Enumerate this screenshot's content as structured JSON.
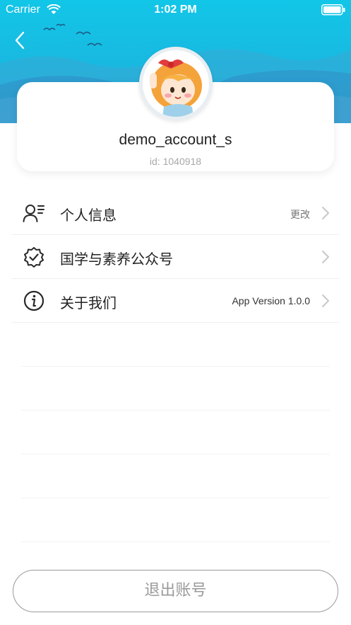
{
  "status_bar": {
    "carrier": "Carrier",
    "time": "1:02 PM"
  },
  "colors": {
    "banner_top": "#12c6e8",
    "banner_bottom": "#2aa9d8",
    "text_primary": "#222222",
    "text_muted": "#a8a8a8",
    "button_border": "#9a9a9a"
  },
  "header": {
    "back_icon": "chevron-left-icon"
  },
  "profile": {
    "username": "demo_account_s",
    "user_id": "id: 1040918",
    "avatar": "cartoon-girl-avatar"
  },
  "menu": [
    {
      "icon": "user-list-icon",
      "label": "个人信息",
      "value": "更改"
    },
    {
      "icon": "verified-badge-icon",
      "label": "国学与素养公众号",
      "value": ""
    },
    {
      "icon": "info-circle-icon",
      "label": "关于我们",
      "value": "App Version 1.0.0"
    }
  ],
  "logout": {
    "label": "退出账号"
  }
}
